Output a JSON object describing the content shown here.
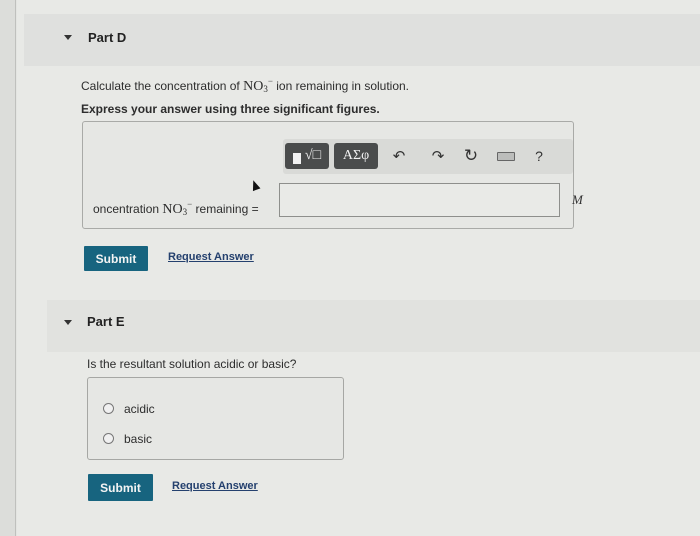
{
  "part_d": {
    "title": "Part D",
    "question_prefix": "Calculate the concentration of",
    "ion_formula": "NO",
    "ion_subscript": "3",
    "ion_charge": "−",
    "question_suffix": "ion remaining in solution.",
    "instruction": "Express your answer using three significant figures.",
    "toolbar": {
      "templates_label": "√□",
      "symbols_label": "ΑΣφ",
      "undo_icon": "↶",
      "redo_icon": "↷",
      "reset_icon": "↻",
      "help_label": "?"
    },
    "answer_label_prefix": "oncentration",
    "answer_label_formula": "NO",
    "answer_label_subscript": "3",
    "answer_label_charge": "−",
    "answer_label_suffix": "remaining =",
    "answer_value": "",
    "unit": "M",
    "submit_label": "Submit",
    "request_answer_label": "Request Answer"
  },
  "part_e": {
    "title": "Part E",
    "question": "Is the resultant solution acidic or basic?",
    "choices": [
      {
        "label": "acidic",
        "selected": false
      },
      {
        "label": "basic",
        "selected": false
      }
    ],
    "submit_label": "Submit",
    "request_answer_label": "Request Answer"
  },
  "colors": {
    "submit_bg": "#17647f",
    "link": "#24406e",
    "toolbar_dark": "#4a4c4c"
  }
}
